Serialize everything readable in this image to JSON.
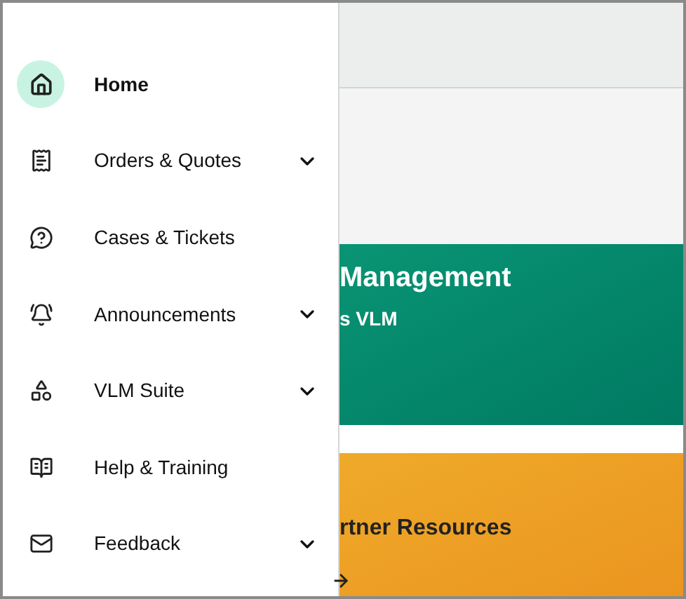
{
  "nav": {
    "items": [
      {
        "label": "Home",
        "selected": true,
        "expandable": false
      },
      {
        "label": "Orders & Quotes",
        "selected": false,
        "expandable": true
      },
      {
        "label": "Cases & Tickets",
        "selected": false,
        "expandable": false
      },
      {
        "label": "Announcements",
        "selected": false,
        "expandable": true
      },
      {
        "label": "VLM Suite",
        "selected": false,
        "expandable": true
      },
      {
        "label": "Help & Training",
        "selected": false,
        "expandable": false
      },
      {
        "label": "Feedback",
        "selected": false,
        "expandable": true
      }
    ]
  },
  "main": {
    "banners": [
      {
        "kind": "teal",
        "title": "Management",
        "subtitle": "s VLM"
      },
      {
        "kind": "orange",
        "title": "rtner Resources"
      }
    ]
  }
}
